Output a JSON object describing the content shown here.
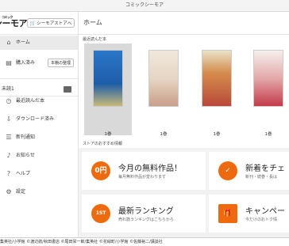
{
  "window": {
    "title": "コミックシーモア"
  },
  "logo": {
    "text": "シーモア",
    "small": "コミック"
  },
  "sidebar": {
    "store_button": "シーモアストアへ",
    "home": "ホーム",
    "purchased": "購入済み",
    "shelf_order": "本棚の整理",
    "unread": "未読1",
    "items": [
      {
        "label": "最近読んだ本",
        "icon": "clock-icon"
      },
      {
        "label": "ダウンロード済み",
        "icon": "download-icon"
      },
      {
        "label": "新刊通知",
        "icon": "bell-list-icon"
      },
      {
        "label": "お知らせ",
        "icon": "bell-icon"
      },
      {
        "label": "ヘルプ",
        "icon": "help-icon"
      },
      {
        "label": "設定",
        "icon": "gear-icon"
      }
    ]
  },
  "main": {
    "header": "ホーム",
    "recent_title": "最近読んだ本",
    "books": [
      {
        "volume": "1巻"
      },
      {
        "volume": "1巻"
      },
      {
        "volume": "1巻"
      },
      {
        "volume": "1巻"
      }
    ],
    "store_title": "ストアのおすすめ情報",
    "cards": [
      {
        "title": "今月の無料作品！",
        "sub": "毎月無料作品が変わります",
        "icon": "0円"
      },
      {
        "title": "新着をチェ",
        "sub": "新刊・続巻・長は",
        "icon": "✓"
      },
      {
        "title": "最新ランキング",
        "sub": "売れ筋ランキングはこちらから",
        "icon": "1ST"
      },
      {
        "title": "キャンペー",
        "sub": "今だけのおトク情",
        "icon": "🎁"
      }
    ]
  },
  "footer": {
    "text": "集英社/小学館 ©渡辺航/秋田書店 ©尾田栄一郎/集英社 ©花緑町/小学館 ©佐藤裕二/講談社"
  },
  "colors": {
    "accent": "#ee6a0e",
    "selected_bg": "#d9d9d9"
  }
}
